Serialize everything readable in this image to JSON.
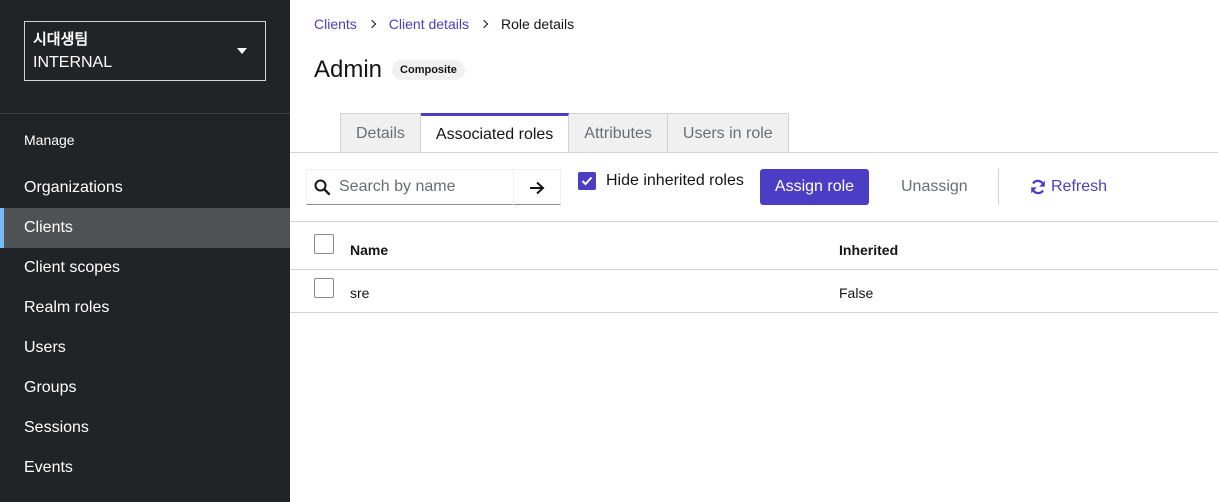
{
  "sidebar": {
    "realm": {
      "name": "시대생팀",
      "sub": "INTERNAL"
    },
    "section_label": "Manage",
    "items": [
      {
        "label": "Organizations"
      },
      {
        "label": "Clients"
      },
      {
        "label": "Client scopes"
      },
      {
        "label": "Realm roles"
      },
      {
        "label": "Users"
      },
      {
        "label": "Groups"
      },
      {
        "label": "Sessions"
      },
      {
        "label": "Events"
      }
    ],
    "active_item": "Clients"
  },
  "breadcrumb": [
    {
      "label": "Clients"
    },
    {
      "label": "Client details"
    },
    {
      "label": "Role details"
    }
  ],
  "page": {
    "title": "Admin",
    "badge": "Composite"
  },
  "tabs": [
    {
      "label": "Details"
    },
    {
      "label": "Associated roles"
    },
    {
      "label": "Attributes"
    },
    {
      "label": "Users in role"
    }
  ],
  "active_tab": "Associated roles",
  "toolbar": {
    "search_placeholder": "Search by name",
    "hide_inherited_label": "Hide inherited roles",
    "hide_inherited_checked": true,
    "assign_label": "Assign role",
    "unassign_label": "Unassign",
    "refresh_label": "Refresh"
  },
  "table": {
    "columns": [
      "Name",
      "Inherited"
    ],
    "rows": [
      {
        "name": "sre",
        "inherited": "False"
      }
    ]
  },
  "colors": {
    "accent": "#4b3ec4",
    "sidebar_bg": "#212427",
    "sidebar_active_bg": "#4f5255",
    "sidebar_active_border": "#73bcf7"
  },
  "icons": {
    "search": "search-icon",
    "go": "arrow-right-icon",
    "refresh": "refresh-icon",
    "caret": "caret-down-icon",
    "check": "check-icon"
  }
}
